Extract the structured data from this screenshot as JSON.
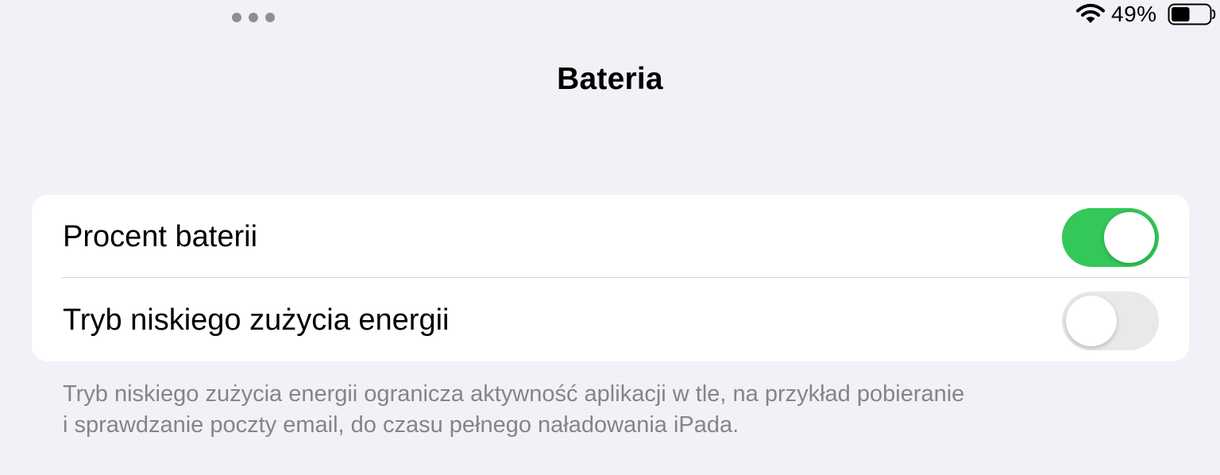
{
  "status_bar": {
    "battery_percent": "49%",
    "battery_level": 0.49,
    "icons": [
      "multitasking-dots-icon",
      "wifi-icon",
      "battery-icon"
    ]
  },
  "header": {
    "title": "Bateria"
  },
  "settings": {
    "rows": [
      {
        "label": "Procent baterii",
        "enabled": true
      },
      {
        "label": "Tryb niskiego zużycia energii",
        "enabled": false
      }
    ],
    "footer": {
      "line1": "Tryb niskiego zużycia energii ogranicza aktywność aplikacji w tle, na przykład pobieranie",
      "line2": "i sprawdzanie poczty email, do czasu pełnego naładowania iPada."
    }
  },
  "colors": {
    "background": "#f2f1f7",
    "toggle_on": "#34c759",
    "toggle_off": "#e9e9eb",
    "footer_text": "#848489"
  }
}
